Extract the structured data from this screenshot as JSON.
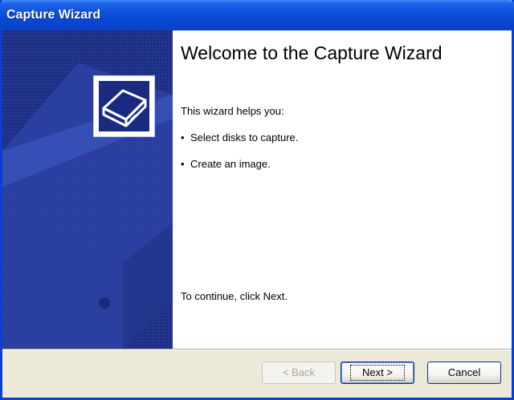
{
  "window": {
    "title": "Capture Wizard"
  },
  "content": {
    "heading": "Welcome to the Capture Wizard",
    "intro": "This wizard helps you:",
    "bullets": [
      "Select disks to capture.",
      "Create an image."
    ],
    "bullet_symbol": "•",
    "continue_text": "To continue, click Next."
  },
  "buttons": {
    "back": "< Back",
    "next": "Next >",
    "cancel": "Cancel"
  },
  "icons": {
    "wizard": "disk-drive-icon"
  },
  "colors": {
    "title_bar": "#0a4fd9",
    "sidebar": "#1f2f86",
    "dialog_bg": "#ece9d8"
  }
}
